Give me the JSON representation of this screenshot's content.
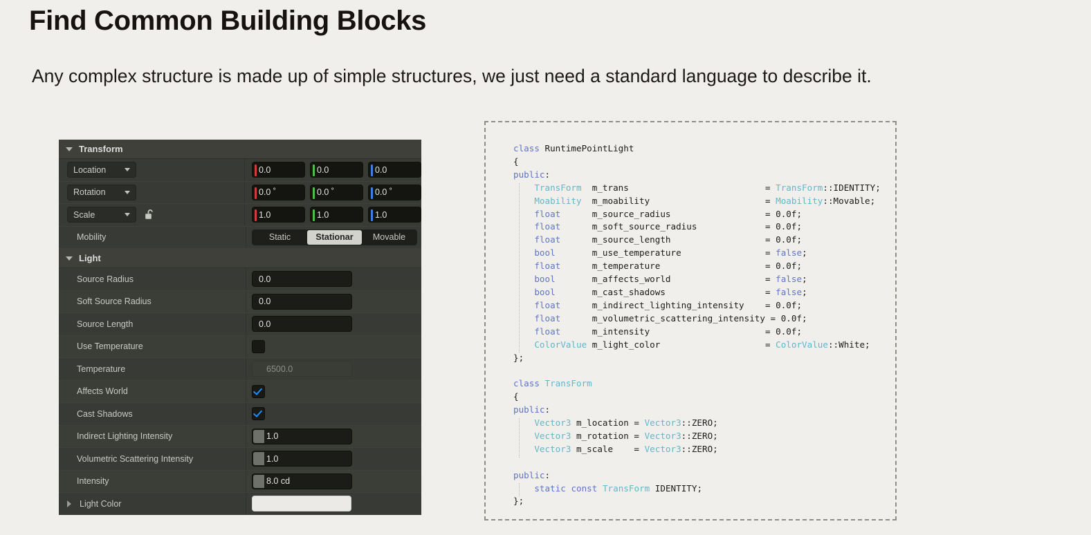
{
  "slide": {
    "title": "Find Common Building Blocks",
    "subtitle": "Any complex structure is made up of simple structures, we just need a standard language to describe it."
  },
  "details_panel": {
    "sections": [
      {
        "name": "Transform",
        "expanded": true,
        "rows": [
          {
            "kind": "vector",
            "dropdown_label": "Location",
            "axes": [
              {
                "axis": "X",
                "value": "0.0",
                "color": "#d43b3b"
              },
              {
                "axis": "Y",
                "value": "0.0",
                "color": "#4dbd4d"
              },
              {
                "axis": "Z",
                "value": "0.0",
                "color": "#3f7fe0"
              }
            ]
          },
          {
            "kind": "vector",
            "dropdown_label": "Rotation",
            "axes": [
              {
                "axis": "X",
                "value": "0.0 ˚",
                "color": "#d43b3b"
              },
              {
                "axis": "Y",
                "value": "0.0 ˚",
                "color": "#4dbd4d"
              },
              {
                "axis": "Z",
                "value": "0.0 ˚",
                "color": "#3f7fe0"
              }
            ]
          },
          {
            "kind": "vector",
            "dropdown_label": "Scale",
            "lock": "unlocked-padlock",
            "axes": [
              {
                "axis": "X",
                "value": "1.0",
                "color": "#d43b3b"
              },
              {
                "axis": "Y",
                "value": "1.0",
                "color": "#4dbd4d"
              },
              {
                "axis": "Z",
                "value": "1.0",
                "color": "#3f7fe0"
              }
            ]
          },
          {
            "kind": "segmented",
            "label": "Mobility",
            "options": [
              "Static",
              "Stationar",
              "Movable"
            ],
            "selected": "Stationar"
          }
        ]
      },
      {
        "name": "Light",
        "expanded": true,
        "rows": [
          {
            "kind": "number",
            "label": "Source Radius",
            "value": "0.0"
          },
          {
            "kind": "number",
            "label": "Soft Source Radius",
            "value": "0.0"
          },
          {
            "kind": "number",
            "label": "Source Length",
            "value": "0.0"
          },
          {
            "kind": "checkbox",
            "label": "Use Temperature",
            "checked": false
          },
          {
            "kind": "number",
            "label": "Temperature",
            "value": "6500.0",
            "disabled": true
          },
          {
            "kind": "checkbox",
            "label": "Affects World",
            "checked": true
          },
          {
            "kind": "checkbox",
            "label": "Cast Shadows",
            "checked": true
          },
          {
            "kind": "slider",
            "label": "Indirect Lighting Intensity",
            "value": "1.0"
          },
          {
            "kind": "slider",
            "label": "Volumetric Scattering Intensity",
            "value": "1.0"
          },
          {
            "kind": "slider",
            "label": "Intensity",
            "value": "8.0 cd"
          },
          {
            "kind": "color",
            "label": "Light Color",
            "value": "#ECEAE6",
            "expandable": true
          }
        ]
      }
    ]
  },
  "code_block": {
    "language": "cpp",
    "lines": [
      "class RuntimePointLight",
      "{",
      "public:",
      "    TransForm  m_trans                          = TransForm::IDENTITY;",
      "    Moability  m_moability                      = Moability::Movable;",
      "    float      m_source_radius                  = 0.0f;",
      "    float      m_soft_source_radius             = 0.0f;",
      "    float      m_source_length                  = 0.0f;",
      "    bool       m_use_temperature                = false;",
      "    float      m_temperature                    = 0.0f;",
      "    bool       m_affects_world                  = false;",
      "    bool       m_cast_shadows                   = false;",
      "    float      m_indirect_lighting_intensity    = 0.0f;",
      "    float      m_volumetric_scattering_intensity = 0.0f;",
      "    float      m_intensity                      = 0.0f;",
      "    ColorValue m_light_color                    = ColorValue::White;",
      "};",
      "",
      "class TransForm",
      "{",
      "public:",
      "    Vector3 m_location = Vector3::ZERO;",
      "    Vector3 m_rotation = Vector3::ZERO;",
      "    Vector3 m_scale    = Vector3::ZERO;",
      "",
      "public:",
      "    static const TransForm IDENTITY;",
      "};"
    ]
  }
}
